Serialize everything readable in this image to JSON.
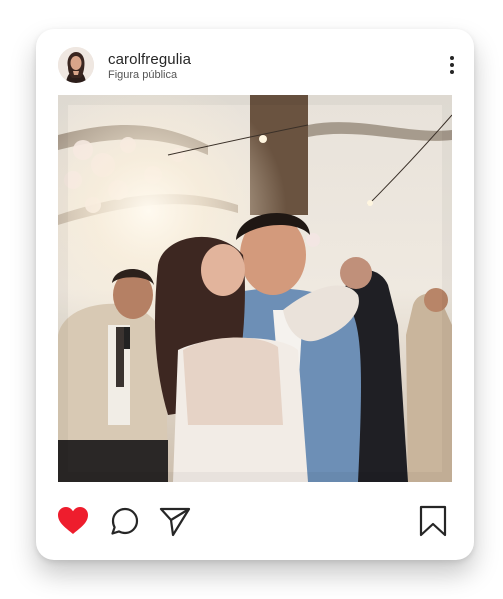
{
  "post": {
    "username": "carolfregulia",
    "subtitle": "Figura pública",
    "liked": true
  },
  "icons": {
    "more": "more-vertical-icon",
    "like": "heart-icon",
    "comment": "comment-icon",
    "share": "send-icon",
    "save": "bookmark-icon"
  },
  "colors": {
    "like": "#ee1d2d",
    "text": "#262626",
    "icon_stroke": "#262626"
  }
}
